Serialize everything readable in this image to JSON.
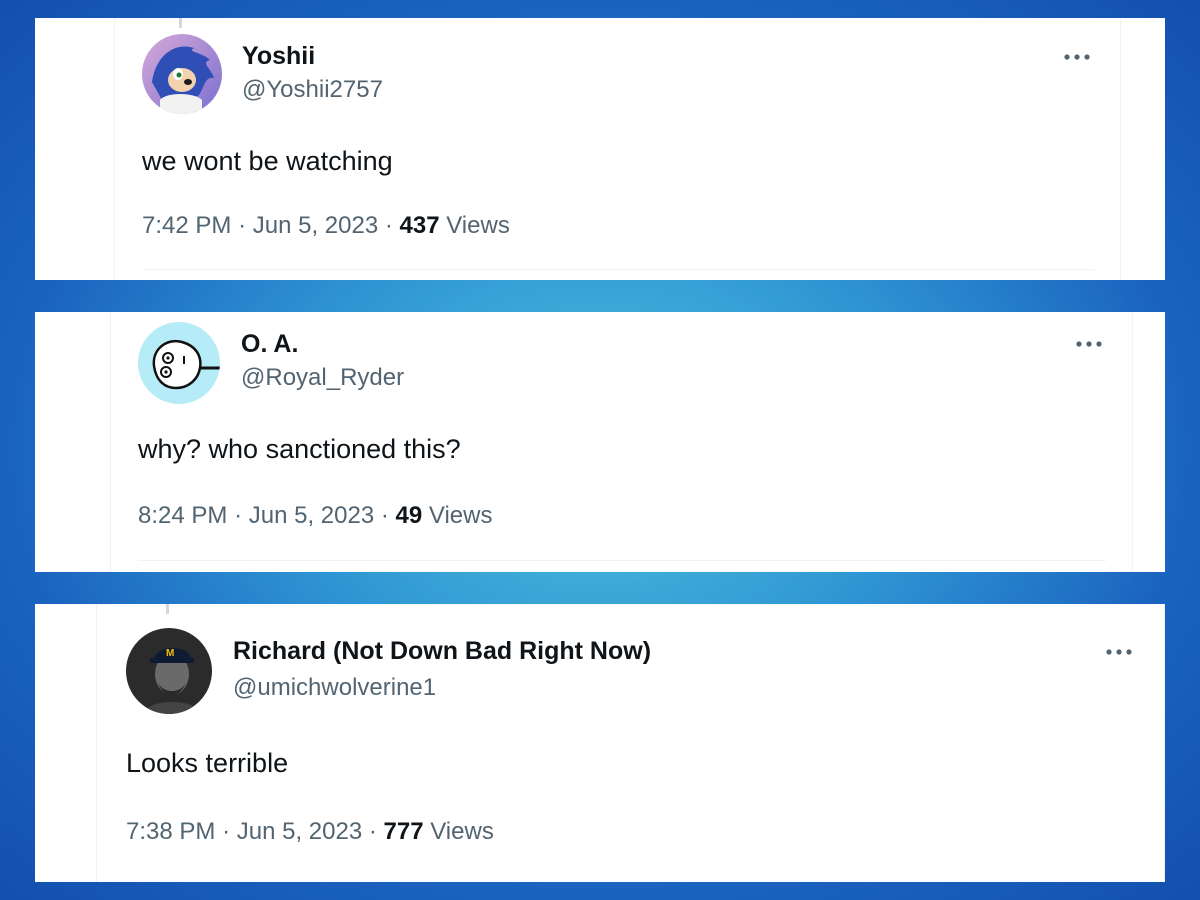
{
  "tweets": [
    {
      "name": "Yoshii",
      "handle": "@Yoshii2757",
      "avatar_icon": "sonic-avatar",
      "text": "we wont be watching",
      "time": "7:42 PM",
      "sep1": "·",
      "date": "Jun 5, 2023",
      "sep2": "·",
      "views_count": "437",
      "views_label": "Views",
      "more_icon": "more-options-icon"
    },
    {
      "name": "O. A.",
      "handle": "@Royal_Ryder",
      "avatar_icon": "cartoon-face-avatar",
      "text": "why? who sanctioned this?",
      "time": "8:24 PM",
      "sep1": "·",
      "date": "Jun 5, 2023",
      "sep2": "·",
      "views_count": "49",
      "views_label": "Views",
      "more_icon": "more-options-icon"
    },
    {
      "name": "Richard (Not Down Bad Right Now)",
      "handle": "@umichwolverine1",
      "avatar_icon": "man-with-cap-avatar",
      "text": "Looks terrible",
      "time": "7:38 PM",
      "sep1": "·",
      "date": "Jun 5, 2023",
      "sep2": "·",
      "views_count": "777",
      "views_label": "Views",
      "more_icon": "more-options-icon"
    }
  ],
  "colors": {
    "text_primary": "#0f1419",
    "text_secondary": "#536471",
    "divider": "#eff3f4",
    "background_gradient_center": "#4ec3dd",
    "background_gradient_edge": "#134fae"
  }
}
